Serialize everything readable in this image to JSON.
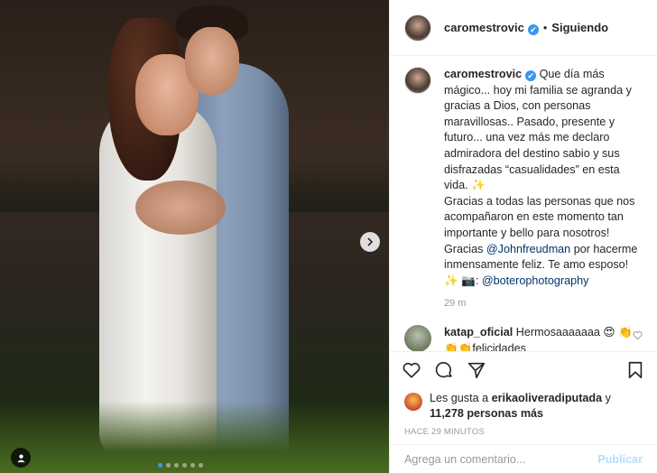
{
  "post": {
    "username": "caromestrovic",
    "verified_mark": "✔",
    "separator": "•",
    "follow_status": "Siguiendo"
  },
  "caption": {
    "username": "caromestrovic",
    "text_1": "Que día más mágico... hoy mi familia se agranda y gracias a Dios, con personas maravillosas.. Pasado, presente y futuro... una vez más me declaro admiradora del destino sabio y sus disfrazadas “casualidades” en esta vida. ✨",
    "text_2": "Gracias a todas las personas que nos acompañaron en este momento tan importante y bello para nosotros!",
    "text_3a": "Gracias ",
    "mention_1": "@Johnfreudman",
    "text_3b": " por hacerme inmensamente feliz. Te amo esposo!",
    "text_4a": "✨ 📷: ",
    "mention_2": "@boterophotography",
    "time": "29 m"
  },
  "reply": {
    "username": "katap_oficial",
    "text": " Hermosaaaaaaa 😍 👏👏👏felicidades"
  },
  "likes": {
    "prefix": "Les gusta a ",
    "user": "erikaoliveradiputada",
    "middle": " y ",
    "count": "11,278 personas más"
  },
  "time_ago": "Hace 29 minutos",
  "comment_box": {
    "placeholder": "Agrega un comentario...",
    "publish_label": "Publicar"
  },
  "icons": {
    "like": "heart-icon",
    "comment": "comment-icon",
    "share": "share-icon",
    "save": "bookmark-icon",
    "next": "chevron-right-icon",
    "tag": "user-tag-icon"
  },
  "colors": {
    "verified": "#3897f0",
    "link": "#003569",
    "muted": "#999999",
    "publish_disabled": "#b2dffc"
  }
}
